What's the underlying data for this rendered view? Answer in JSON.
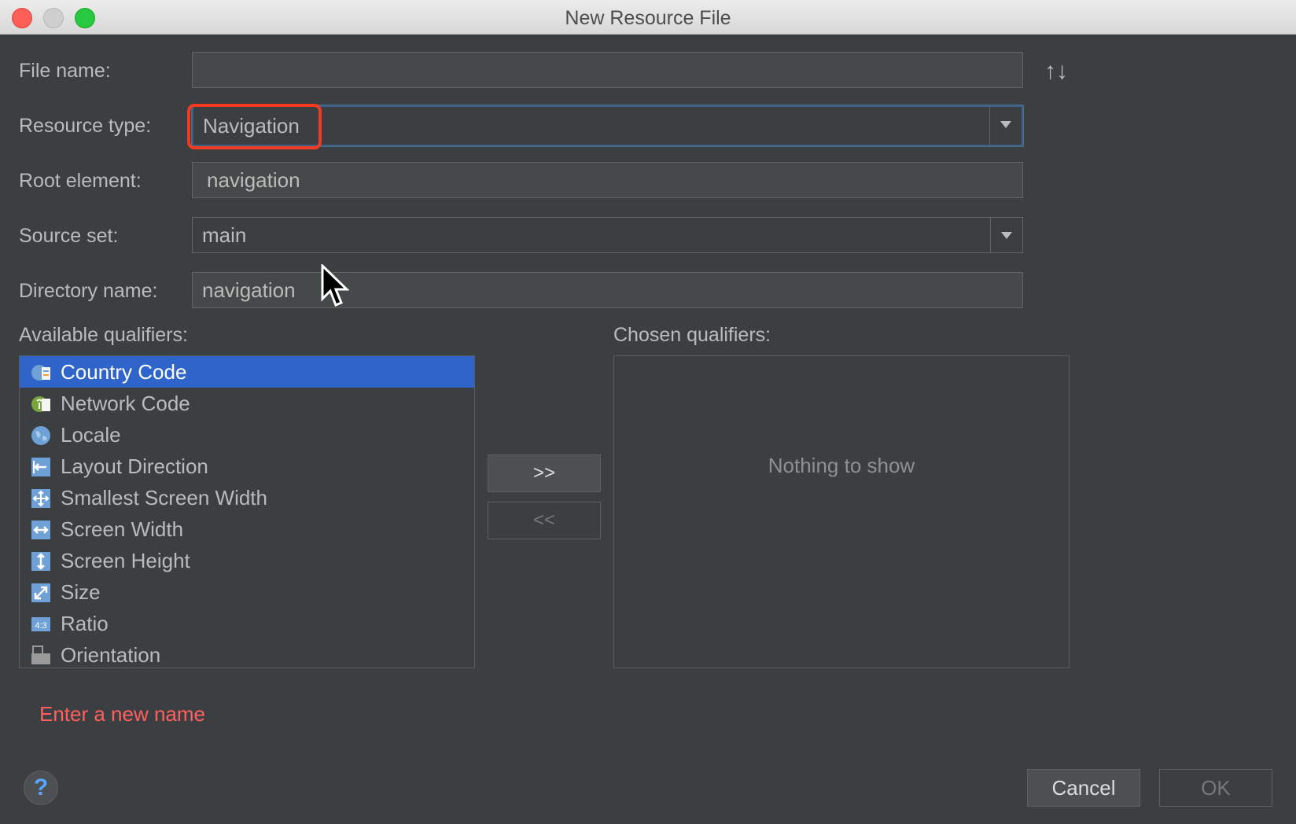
{
  "window": {
    "title": "New Resource File"
  },
  "form": {
    "file_name": {
      "label": "File name:",
      "value": ""
    },
    "resource_type": {
      "label": "Resource type:",
      "value": "Navigation"
    },
    "root_element": {
      "label": "Root element:",
      "value": "navigation"
    },
    "source_set": {
      "label": "Source set:",
      "value": "main"
    },
    "directory_name": {
      "label": "Directory name:",
      "value": "navigation"
    },
    "sort_icon": "sort-up-down-icon"
  },
  "qualifiers": {
    "available_label": "Available qualifiers:",
    "chosen_label": "Chosen qualifiers:",
    "available": [
      {
        "label": "Country Code",
        "icon": "country-code-icon"
      },
      {
        "label": "Network Code",
        "icon": "network-code-icon"
      },
      {
        "label": "Locale",
        "icon": "globe-icon"
      },
      {
        "label": "Layout Direction",
        "icon": "layout-direction-icon"
      },
      {
        "label": "Smallest Screen Width",
        "icon": "move-icon"
      },
      {
        "label": "Screen Width",
        "icon": "horizontal-arrows-icon"
      },
      {
        "label": "Screen Height",
        "icon": "vertical-arrows-icon"
      },
      {
        "label": "Size",
        "icon": "diagonal-arrow-icon"
      },
      {
        "label": "Ratio",
        "icon": "ratio-icon"
      },
      {
        "label": "Orientation",
        "icon": "orientation-icon"
      }
    ],
    "add_button": ">>",
    "remove_button": "<<",
    "chosen_empty": "Nothing to show"
  },
  "error_message": "Enter a new name",
  "buttons": {
    "help": "?",
    "cancel": "Cancel",
    "ok": "OK"
  },
  "colors": {
    "background": "#3c3f41",
    "selection": "#2f65ca",
    "error": "#ff5f5f",
    "highlight": "#f23a20"
  }
}
